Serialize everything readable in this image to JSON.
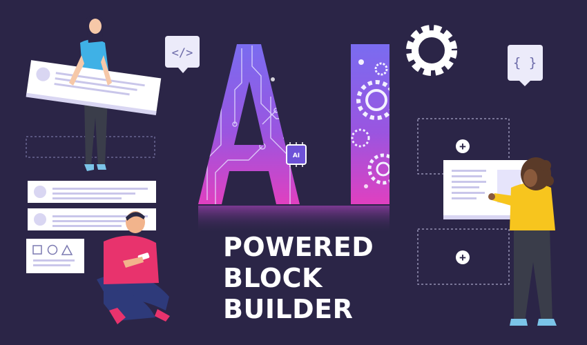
{
  "headline": {
    "line1": "POWERED",
    "line2": "BLOCK",
    "line3": "BUILDER"
  },
  "hero_letters": "AI",
  "chip_label": "AI",
  "bubble_code": "</>",
  "bubble_braces": "{ }",
  "plus_symbol": "+",
  "colors": {
    "background": "#2b2547",
    "text": "#ffffff",
    "gradient_top": "#7a6cf0",
    "gradient_bottom": "#e040c0",
    "card": "#ffffff",
    "card_line": "#c9c6ea",
    "card_accent": "#d9d6f2",
    "cyan_shirt": "#3fb1e6",
    "pink_shirt": "#e8336d",
    "yellow_shirt": "#f7c51e"
  },
  "icons": [
    "code-bubble-icon",
    "braces-bubble-icon",
    "gear-icon",
    "plus-icon",
    "microchip-icon",
    "shapes-icon"
  ]
}
